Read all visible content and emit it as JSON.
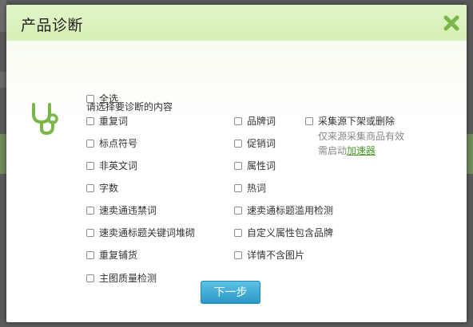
{
  "dialog": {
    "title": "产品诊断",
    "prompt": "请选择要诊断的内容",
    "select_all": "全选",
    "col1": [
      "重复词",
      "标点符号",
      "非英文词",
      "字数",
      "速卖通违禁词",
      "速卖通标题关键词堆砌",
      "重复铺货",
      "主图质量检测"
    ],
    "col2": [
      "品牌词",
      "促销词",
      "属性词",
      "热词",
      "速卖通标题滥用检测",
      "自定义属性包含品牌",
      "详情不含图片"
    ],
    "col3": {
      "label": "采集源下架或删除",
      "note1": "仅来源采集商品有效",
      "note2_prefix": "需启动",
      "note2_link": "加速器"
    },
    "next_button": "下一步"
  },
  "colors": {
    "accent_green": "#7ab648",
    "button_blue": "#2a97c7"
  }
}
